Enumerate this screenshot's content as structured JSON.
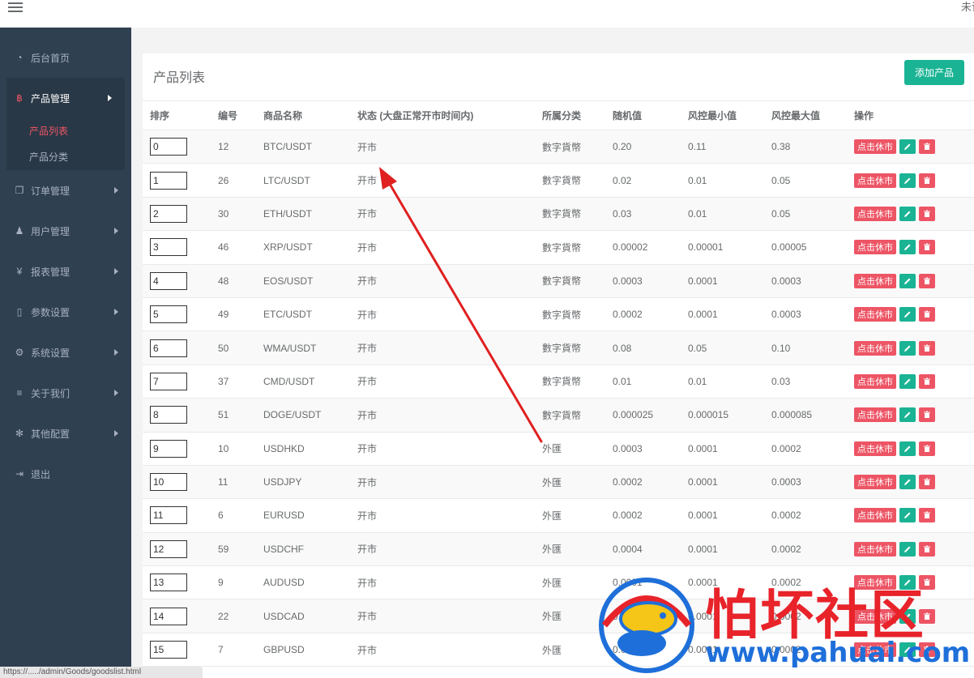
{
  "topbar": {
    "right_text": "未读"
  },
  "sidebar": {
    "items": [
      {
        "label": "后台首页",
        "icon": "dashboard-icon",
        "glyph": "◔"
      },
      {
        "label": "产品管理",
        "icon": "bitcoin-icon",
        "glyph": "฿"
      },
      {
        "label": "订单管理",
        "icon": "copy-icon",
        "glyph": "❐"
      },
      {
        "label": "用户管理",
        "icon": "user-icon",
        "glyph": "♟"
      },
      {
        "label": "报表管理",
        "icon": "yen-icon",
        "glyph": "¥"
      },
      {
        "label": "参数设置",
        "icon": "file-icon",
        "glyph": "▯"
      },
      {
        "label": "系统设置",
        "icon": "cogs-icon",
        "glyph": "⚙"
      },
      {
        "label": "关于我们",
        "icon": "list-icon",
        "glyph": "≡"
      },
      {
        "label": "其他配置",
        "icon": "gear-icon",
        "glyph": "✻"
      },
      {
        "label": "退出",
        "icon": "sign-out-icon",
        "glyph": "⇥"
      }
    ],
    "subitems": [
      {
        "label": "产品列表"
      },
      {
        "label": "产品分类"
      }
    ]
  },
  "panel": {
    "title": "产品列表",
    "add_label": "添加产品"
  },
  "table": {
    "headers": [
      "排序",
      "编号",
      "商品名称",
      "状态 (大盘正常开市时间内)",
      "所属分类",
      "随机值",
      "风控最小值",
      "风控最大值",
      "操作"
    ],
    "action_label": "点击休市",
    "rows": [
      {
        "sort": "0",
        "id": "12",
        "name": "BTC/USDT",
        "status": "开市",
        "category": "數字貨幣",
        "random": "0.20",
        "min": "0.11",
        "max": "0.38"
      },
      {
        "sort": "1",
        "id": "26",
        "name": "LTC/USDT",
        "status": "开市",
        "category": "數字貨幣",
        "random": "0.02",
        "min": "0.01",
        "max": "0.05"
      },
      {
        "sort": "2",
        "id": "30",
        "name": "ETH/USDT",
        "status": "开市",
        "category": "數字貨幣",
        "random": "0.03",
        "min": "0.01",
        "max": "0.05"
      },
      {
        "sort": "3",
        "id": "46",
        "name": "XRP/USDT",
        "status": "开市",
        "category": "數字貨幣",
        "random": "0.00002",
        "min": "0.00001",
        "max": "0.00005"
      },
      {
        "sort": "4",
        "id": "48",
        "name": "EOS/USDT",
        "status": "开市",
        "category": "數字貨幣",
        "random": "0.0003",
        "min": "0.0001",
        "max": "0.0003"
      },
      {
        "sort": "5",
        "id": "49",
        "name": "ETC/USDT",
        "status": "开市",
        "category": "數字貨幣",
        "random": "0.0002",
        "min": "0.0001",
        "max": "0.0003"
      },
      {
        "sort": "6",
        "id": "50",
        "name": "WMA/USDT",
        "status": "开市",
        "category": "數字貨幣",
        "random": "0.08",
        "min": "0.05",
        "max": "0.10"
      },
      {
        "sort": "7",
        "id": "37",
        "name": "CMD/USDT",
        "status": "开市",
        "category": "數字貨幣",
        "random": "0.01",
        "min": "0.01",
        "max": "0.03"
      },
      {
        "sort": "8",
        "id": "51",
        "name": "DOGE/USDT",
        "status": "开市",
        "category": "數字貨幣",
        "random": "0.000025",
        "min": "0.000015",
        "max": "0.000085"
      },
      {
        "sort": "9",
        "id": "10",
        "name": "USDHKD",
        "status": "开市",
        "category": "外匯",
        "random": "0.0003",
        "min": "0.0001",
        "max": "0.0002"
      },
      {
        "sort": "10",
        "id": "11",
        "name": "USDJPY",
        "status": "开市",
        "category": "外匯",
        "random": "0.0002",
        "min": "0.0001",
        "max": "0.0003"
      },
      {
        "sort": "11",
        "id": "6",
        "name": "EURUSD",
        "status": "开市",
        "category": "外匯",
        "random": "0.0002",
        "min": "0.0001",
        "max": "0.0002"
      },
      {
        "sort": "12",
        "id": "59",
        "name": "USDCHF",
        "status": "开市",
        "category": "外匯",
        "random": "0.0004",
        "min": "0.0001",
        "max": "0.0002"
      },
      {
        "sort": "13",
        "id": "9",
        "name": "AUDUSD",
        "status": "开市",
        "category": "外匯",
        "random": "0.0001",
        "min": "0.0001",
        "max": "0.0002"
      },
      {
        "sort": "14",
        "id": "22",
        "name": "USDCAD",
        "status": "开市",
        "category": "外匯",
        "random": "0.0002",
        "min": "0.0001",
        "max": "0.0002"
      },
      {
        "sort": "15",
        "id": "7",
        "name": "GBPUSD",
        "status": "开市",
        "category": "外匯",
        "random": "0.0002",
        "min": "0.0001",
        "max": "0.0002"
      }
    ]
  },
  "watermark": {
    "cn": "怕坏社区",
    "url": "www.pahuai.com"
  },
  "statusbar": {
    "url": "https://...../admin/Goods/goodslist.html"
  },
  "colors": {
    "sidebar": "#2f4050",
    "accent": "#1ab394",
    "danger": "#ed5565",
    "annotation": "#e02020"
  }
}
